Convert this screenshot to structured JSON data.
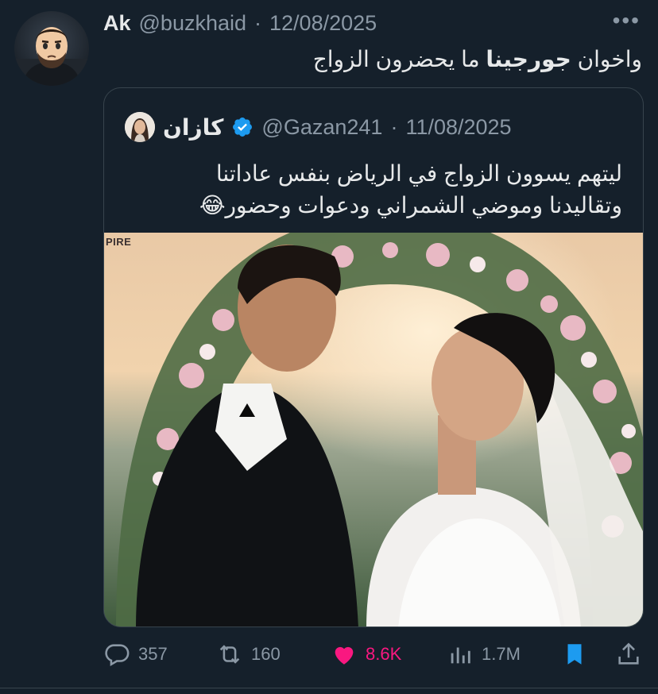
{
  "tweet": {
    "display_name": "Ak",
    "handle": "@buzkhaid",
    "separator": "·",
    "date": "12/08/2025",
    "text_part1": "واخوان ",
    "text_bold": "جورجينا",
    "text_part2": " ما يحضرون الزواج",
    "avatar_icon": "man-emoji-avatar"
  },
  "quote": {
    "display_name": "كازان",
    "verified_icon": "verified-badge-icon",
    "handle": "@Gazan241",
    "separator": "·",
    "date": "11/08/2025",
    "text_line1": "ليتهم يسوون الزواج في الرياض بنفس عاداتنا",
    "text_line2": "وتقاليدنا وموضي الشمراني ودعوات وحضور😂",
    "media_caption": "PIRE"
  },
  "actions": {
    "replies": "357",
    "retweets": "160",
    "likes": "8.6K",
    "views": "1.7M"
  },
  "colors": {
    "background": "#15202b",
    "secondary_text": "#8b98a5",
    "like": "#f91880",
    "bookmark": "#1d9bf0",
    "verified": "#1d9bf0"
  }
}
